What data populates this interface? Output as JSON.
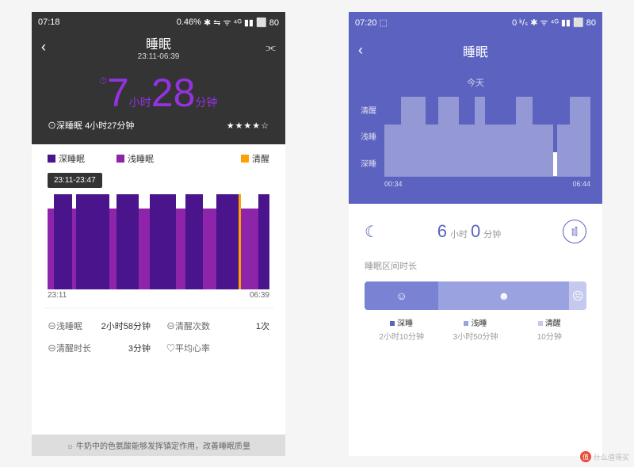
{
  "left": {
    "status": {
      "time": "07:18",
      "data": "0.46% ",
      "icons": "✱ ⇋ ᯤ ⁴ᴳ ▮▮ ⬜ 80"
    },
    "title": "睡眠",
    "subtitle": "23:11-06:39",
    "hours": "7",
    "hours_unit": "小时",
    "minutes": "28",
    "minutes_unit": "分钟",
    "deep_label": "⊙深睡眠",
    "deep_value": "4小时27分钟",
    "stars": "★★★★☆",
    "legend": {
      "deep": "深睡眠",
      "light": "浅睡眠",
      "awake": "清醒"
    },
    "tooltip": "23:11-23:47",
    "time_start": "23:11",
    "time_end": "06:39",
    "stats": {
      "light_label": "⊖浅睡眠",
      "light_val": "2小时58分钟",
      "wake_count_label": "⊖清醒次数",
      "wake_count_val": "1次",
      "wake_dur_label": "⊖清醒时长",
      "wake_dur_val": "3分钟",
      "hr_label": "♡平均心率",
      "hr_val": ""
    },
    "tip": "☼ 牛奶中的色氨酸能够发挥镇定作用，改善睡眠质量"
  },
  "right": {
    "status": {
      "time": "07:20 ⬚",
      "icons": "0 ᵏ/ₛ ✱ ᯤ ⁴ᴳ ▮▮ ⬜ 80"
    },
    "title": "睡眠",
    "today": "今天",
    "ylabels": [
      "清醒",
      "浅睡",
      "深睡"
    ],
    "time_start": "00:34",
    "time_end": "06:44",
    "hours": "6",
    "hours_unit": "小时",
    "minutes": "0",
    "minutes_unit": "分钟",
    "section": "睡眠区间时长",
    "breakdown": {
      "deep": {
        "label": "深睡",
        "dur": "2小时10分钟",
        "icon": "☺"
      },
      "light": {
        "label": "浅睡",
        "dur": "3小时50分钟",
        "icon": "☻"
      },
      "awake": {
        "label": "清醒",
        "dur": "10分钟",
        "icon": "☹"
      }
    }
  },
  "watermark": "什么值得买",
  "chart_data": [
    {
      "type": "bar",
      "title": "Sleep stages 23:11-06:39",
      "categories": [
        "deep",
        "light",
        "awake"
      ],
      "series": [
        {
          "name": "segments",
          "values": [
            {
              "stage": "light",
              "width": 3
            },
            {
              "stage": "deep",
              "width": 8
            },
            {
              "stage": "light",
              "width": 2
            },
            {
              "stage": "deep",
              "width": 15
            },
            {
              "stage": "light",
              "width": 3
            },
            {
              "stage": "deep",
              "width": 10
            },
            {
              "stage": "light",
              "width": 5
            },
            {
              "stage": "deep",
              "width": 12
            },
            {
              "stage": "light",
              "width": 4
            },
            {
              "stage": "deep",
              "width": 8
            },
            {
              "stage": "light",
              "width": 6
            },
            {
              "stage": "deep",
              "width": 10
            },
            {
              "stage": "awake",
              "width": 1
            },
            {
              "stage": "light",
              "width": 8
            },
            {
              "stage": "deep",
              "width": 5
            }
          ]
        }
      ]
    },
    {
      "type": "bar",
      "title": "Sleep stages 00:34-06:44",
      "ylabels": [
        "清醒",
        "浅睡",
        "深睡"
      ],
      "series": [
        {
          "name": "segments",
          "values": [
            {
              "stage": "light",
              "width": 8
            },
            {
              "stage": "deep",
              "width": 12
            },
            {
              "stage": "light",
              "width": 6
            },
            {
              "stage": "deep",
              "width": 10
            },
            {
              "stage": "light",
              "width": 8
            },
            {
              "stage": "deep",
              "width": 5
            },
            {
              "stage": "light",
              "width": 15
            },
            {
              "stage": "deep",
              "width": 8
            },
            {
              "stage": "light",
              "width": 10
            },
            {
              "stage": "awake",
              "width": 2
            },
            {
              "stage": "light",
              "width": 6
            },
            {
              "stage": "deep",
              "width": 10
            }
          ]
        }
      ]
    }
  ]
}
